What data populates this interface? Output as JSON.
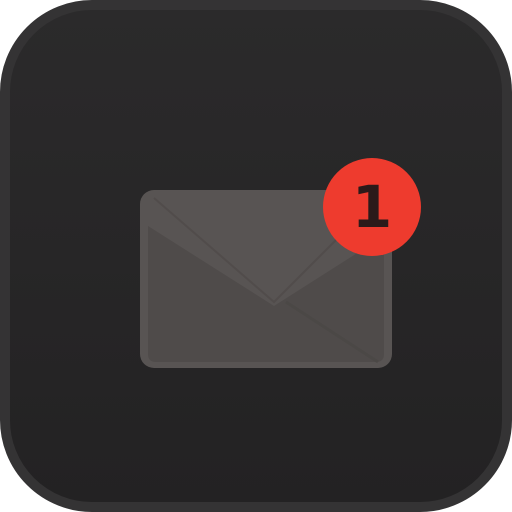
{
  "app_icon": {
    "icon": "mail-icon",
    "badge_count": "1",
    "colors": {
      "background": "#262526",
      "border": "#343334",
      "envelope": "#585453",
      "envelope_shade": "#4a4745",
      "badge": "#ee3b2e",
      "badge_text": "#2b1a1a"
    }
  }
}
